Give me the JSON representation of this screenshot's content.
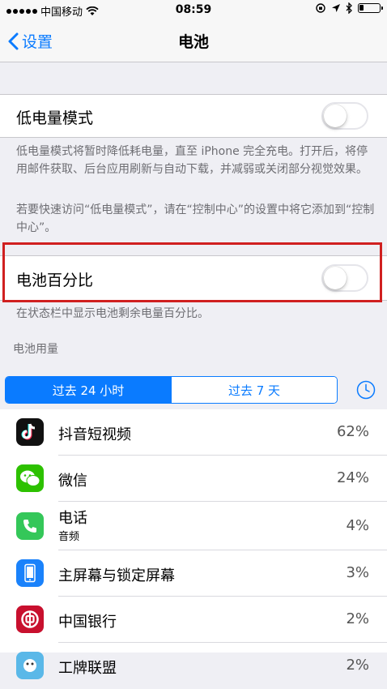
{
  "status_bar": {
    "carrier": "中国移动",
    "time": "08:59"
  },
  "nav": {
    "back_label": "设置",
    "title": "电池"
  },
  "low_power": {
    "label": "低电量模式",
    "enabled": false,
    "footnote_1": "低电量模式将暂时降低耗电量，直至 iPhone 完全充电。打开后，将停用邮件获取、后台应用刷新与自动下载，并减弱或关闭部分视觉效果。",
    "footnote_2": "若要快速访问“低电量模式”，请在“控制中心”的设置中将它添加到“控制中心”。"
  },
  "battery_percentage": {
    "label": "电池百分比",
    "enabled": false,
    "footnote": "在状态栏中显示电池剩余电量百分比。"
  },
  "usage": {
    "header": "电池用量",
    "tabs": [
      {
        "label": "过去 24 小时",
        "selected": true
      },
      {
        "label": "过去 7 天",
        "selected": false
      }
    ],
    "apps": [
      {
        "name": "抖音短视频",
        "sub": "",
        "percent": "62%",
        "icon": "douyin-icon"
      },
      {
        "name": "微信",
        "sub": "",
        "percent": "24%",
        "icon": "wechat-icon"
      },
      {
        "name": "电话",
        "sub": "音频",
        "percent": "4%",
        "icon": "phone-icon"
      },
      {
        "name": "主屏幕与锁定屏幕",
        "sub": "",
        "percent": "3%",
        "icon": "homescreen-icon"
      },
      {
        "name": "中国银行",
        "sub": "",
        "percent": "2%",
        "icon": "boc-icon"
      },
      {
        "name": "工牌联盟",
        "sub": "",
        "percent": "2%",
        "icon": "app-icon"
      }
    ]
  },
  "colors": {
    "accent": "#0a7bff",
    "highlight_box": "#d02020",
    "background": "#efeff4"
  }
}
